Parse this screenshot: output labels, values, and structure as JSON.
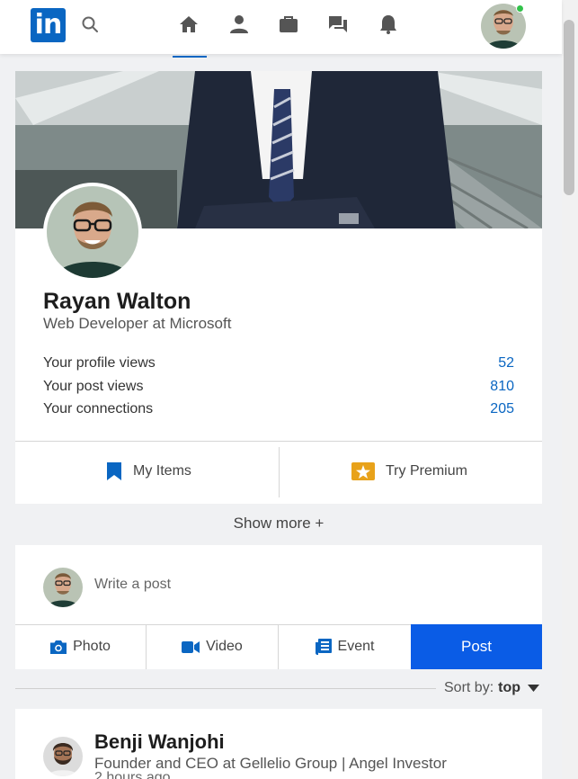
{
  "colors": {
    "brand": "#0a66c2",
    "post_button": "#0a5ce6",
    "online": "#31c24a",
    "premium": "#f5a623"
  },
  "nav": {
    "logo_text": "in",
    "icons": [
      "search-icon",
      "home-icon",
      "person-icon",
      "briefcase-icon",
      "messages-icon",
      "bell-icon"
    ],
    "active": "home"
  },
  "profile": {
    "name": "Rayan Walton",
    "headline": "Web Developer at Microsoft",
    "stats": [
      {
        "label": "Your profile views",
        "value": "52"
      },
      {
        "label": "Your post views",
        "value": "810"
      },
      {
        "label": "Your connections",
        "value": "205"
      }
    ],
    "actions": {
      "my_items": "My Items",
      "try_premium": "Try Premium"
    }
  },
  "show_more": "Show more +",
  "composer": {
    "placeholder": "Write a post",
    "photo": "Photo",
    "video": "Video",
    "event": "Event",
    "post": "Post"
  },
  "sort": {
    "label": "Sort by:",
    "value": "top"
  },
  "feed": [
    {
      "name": "Benji Wanjohi",
      "title": "Founder and CEO at Gellelio Group | Angel Investor",
      "time": "2 hours ago"
    }
  ]
}
